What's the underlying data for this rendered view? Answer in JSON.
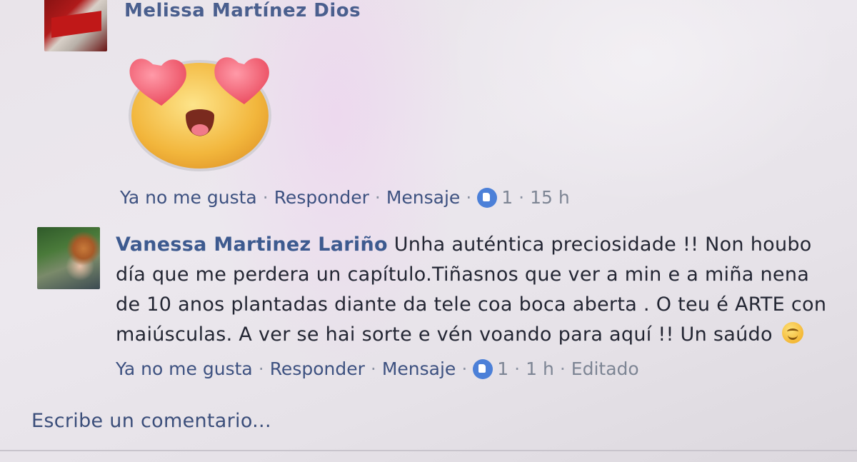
{
  "comments": [
    {
      "author": "Melissa Martínez Dios",
      "sticker": "heart-eyes-emoji-sticker",
      "actions": {
        "unlike": "Ya no me gusta",
        "reply": "Responder",
        "message": "Mensaje",
        "likes": "1",
        "time": "15 h"
      }
    },
    {
      "author": "Vanessa Martinez Lariño",
      "text": "Unha auténtica preciosidade !! Non houbo día que me perdera un capítulo.Tiñasnos que ver a min e a miña nena de 10 anos plantadas diante da tele coa boca aberta . O teu é ARTE con maiúsculas. A ver se hai sorte e vén voando para aquí !! Un saúdo",
      "emoji": "smiling-face-icon",
      "actions": {
        "unlike": "Ya no me gusta",
        "reply": "Responder",
        "message": "Mensaje",
        "likes": "1",
        "time": "1 h",
        "edited": "Editado"
      }
    }
  ],
  "separator": "·",
  "write_comment": {
    "placeholder": "Escribe un comentario..."
  },
  "colors": {
    "link": "#3b5998",
    "like_badge": "#4c80d8",
    "meta": "#7d8594"
  }
}
